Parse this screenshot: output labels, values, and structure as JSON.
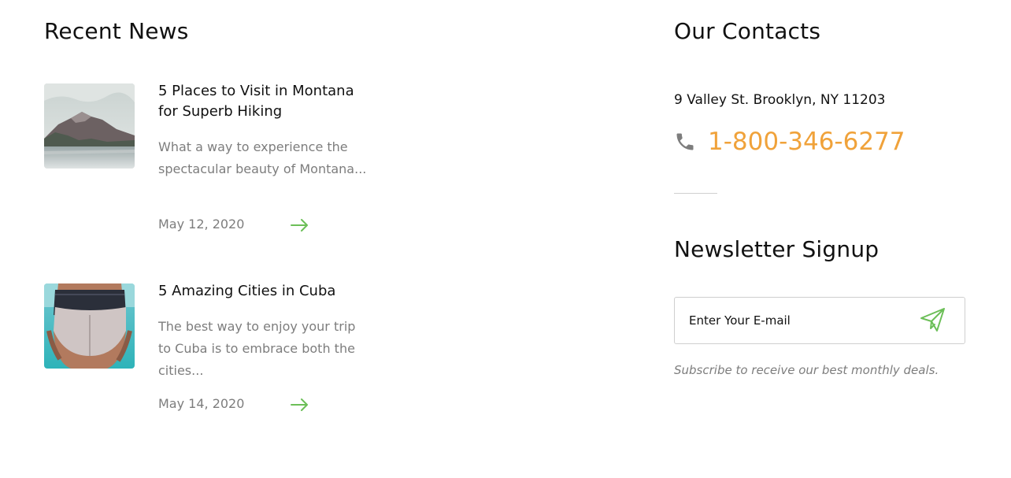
{
  "recent_news": {
    "title": "Recent News",
    "items": [
      {
        "title": "5 Places to Visit in Montana for Superb Hiking",
        "excerpt": "What a way to experience the spectacular beauty of Montana...",
        "date": "May 12, 2020",
        "thumbnail": "mountain-lake-photo",
        "read_more_icon": "arrow-right-icon"
      },
      {
        "title": "5 Amazing Cities in Cuba",
        "excerpt": "The best way to enjoy your trip to Cuba is to embrace both the cities...",
        "date": "May 14, 2020",
        "thumbnail": "beach-swimsuit-photo",
        "read_more_icon": "arrow-right-icon"
      }
    ]
  },
  "contacts": {
    "title": "Our Contacts",
    "address": "9 Valley St. Brooklyn, NY 11203",
    "phone_icon": "phone-icon",
    "phone": "1-800-346-6277"
  },
  "newsletter": {
    "title": "Newsletter Signup",
    "email_placeholder": "Enter Your E-mail",
    "email_value": "",
    "send_icon": "paper-plane-icon",
    "note": "Subscribe to receive our best monthly deals."
  },
  "colors": {
    "accent_orange": "#f0a23a",
    "accent_green": "#6cbf58",
    "muted_text": "#7d7d7d",
    "heading_text": "#111111"
  }
}
